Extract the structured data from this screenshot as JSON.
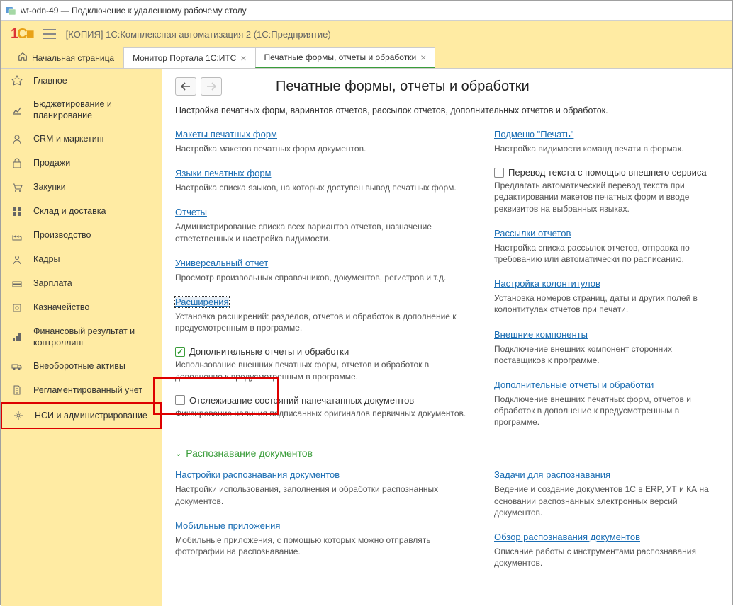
{
  "window": {
    "title": "wt-odn-49 — Подключение к удаленному рабочему столу"
  },
  "app": {
    "title": "[КОПИЯ] 1С:Комплексная автоматизация 2  (1С:Предприятие)"
  },
  "tabs": {
    "home": "Начальная страница",
    "items": [
      {
        "label": "Монитор Портала 1С:ИТС",
        "active": false
      },
      {
        "label": "Печатные формы, отчеты и обработки",
        "active": true
      }
    ]
  },
  "sidebar": [
    {
      "icon": "star",
      "label": "Главное"
    },
    {
      "icon": "chart",
      "label": "Бюджетирование и планирование"
    },
    {
      "icon": "person",
      "label": "CRM и маркетинг"
    },
    {
      "icon": "bag",
      "label": "Продажи"
    },
    {
      "icon": "cart",
      "label": "Закупки"
    },
    {
      "icon": "grid",
      "label": "Склад и доставка"
    },
    {
      "icon": "factory",
      "label": "Производство"
    },
    {
      "icon": "user",
      "label": "Кадры"
    },
    {
      "icon": "money",
      "label": "Зарплата"
    },
    {
      "icon": "safe",
      "label": "Казначейство"
    },
    {
      "icon": "bars",
      "label": "Финансовый результат и контроллинг"
    },
    {
      "icon": "truck",
      "label": "Внеоборотные активы"
    },
    {
      "icon": "doc",
      "label": "Регламентированный учет"
    },
    {
      "icon": "gear",
      "label": "НСИ и администрирование",
      "boxed": true
    }
  ],
  "page": {
    "title": "Печатные формы, отчеты и обработки",
    "subtitle": "Настройка печатных форм, вариантов отчетов, рассылок отчетов, дополнительных отчетов и обработок."
  },
  "col1": [
    {
      "link": "Макеты печатных форм",
      "desc": "Настройка макетов печатных форм документов."
    },
    {
      "link": "Языки печатных форм",
      "desc": "Настройка списка языков, на которых доступен вывод печатных форм."
    },
    {
      "link": "Отчеты",
      "desc": "Администрирование списка всех вариантов отчетов, назначение ответственных и настройка видимости."
    },
    {
      "link": "Универсальный отчет",
      "desc": "Просмотр произвольных справочников, документов, регистров и т.д."
    },
    {
      "link": "Расширения",
      "desc": "Установка расширений: разделов, отчетов и обработок в дополнение к предусмотренным в программе.",
      "boxed": true
    },
    {
      "check": true,
      "checked": true,
      "label": "Дополнительные отчеты и обработки",
      "desc": "Использование внешних печатных форм, отчетов и обработок в дополнение к предусмотренным в программе."
    },
    {
      "check": true,
      "checked": false,
      "label": "Отслеживание состояний напечатанных документов",
      "desc": "Фиксирование наличия подписанных оригиналов первичных документов."
    }
  ],
  "col2": [
    {
      "link": "Подменю \"Печать\"",
      "desc": "Настройка видимости команд печати в формах."
    },
    {
      "check": true,
      "checked": false,
      "label": "Перевод текста с помощью внешнего сервиса",
      "desc": "Предлагать автоматический перевод текста при редактировании макетов печатных форм и вводе реквизитов на выбранных языках."
    },
    {
      "link": "Рассылки отчетов",
      "desc": "Настройка списка рассылок отчетов, отправка по требованию или автоматически по расписанию."
    },
    {
      "link": "Настройка колонтитулов",
      "desc": "Установка номеров страниц, даты и других полей в колонтитулах отчетов при печати."
    },
    {
      "link": "Внешние компоненты",
      "desc": "Подключение внешних компонент сторонних поставщиков к программе."
    },
    {
      "link": "Дополнительные отчеты и обработки",
      "desc": "Подключение внешних печатных форм, отчетов и обработок в дополнение к предусмотренным в программе."
    }
  ],
  "section2": {
    "title": "Распознавание документов",
    "col1": [
      {
        "link": "Настройки распознавания документов",
        "desc": "Настройки использования, заполнения и обработки распознанных документов."
      },
      {
        "link": "Мобильные приложения",
        "desc": "Мобильные приложения, с помощью которых можно отправлять фотографии на распознавание."
      }
    ],
    "col2": [
      {
        "link": "Задачи для распознавания",
        "desc": "Ведение и создание документов 1С в ERP, УТ и КА на основании распознанных электронных версий документов."
      },
      {
        "link": "Обзор распознавания документов",
        "desc": "Описание работы с инструментами распознавания документов."
      }
    ]
  }
}
